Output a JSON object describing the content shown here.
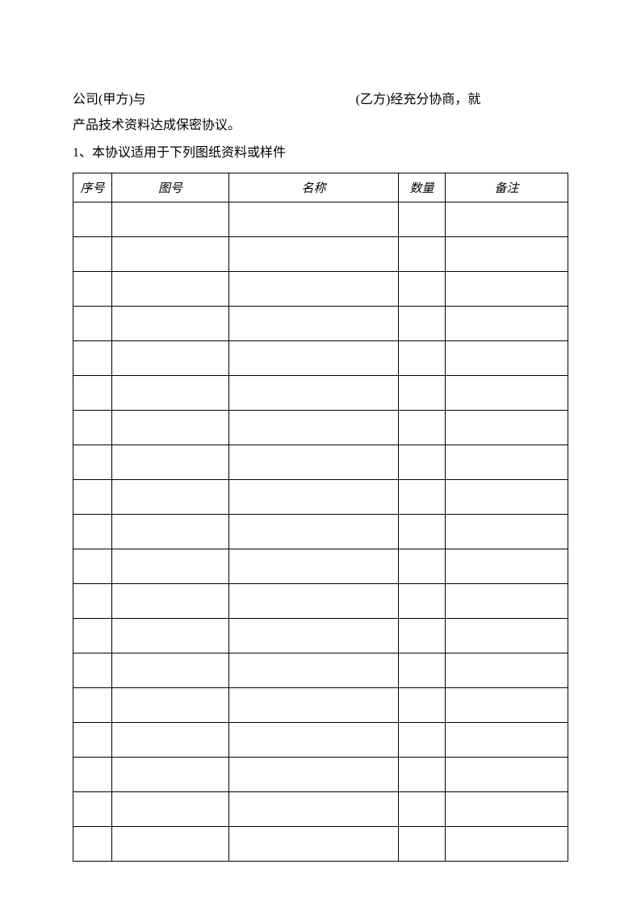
{
  "intro": {
    "party_a_prefix": "公司(甲方)与",
    "party_b_prefix": "(乙方)经充分协商，就",
    "line2": "产品技术资料达成保密协议。"
  },
  "clause1": "1、本协议适用于下列图纸资料或样件",
  "table": {
    "headers": {
      "seq": "序号",
      "fig": "图号",
      "name": "名称",
      "qty": "数量",
      "note": "备注"
    },
    "row_count": 19
  }
}
